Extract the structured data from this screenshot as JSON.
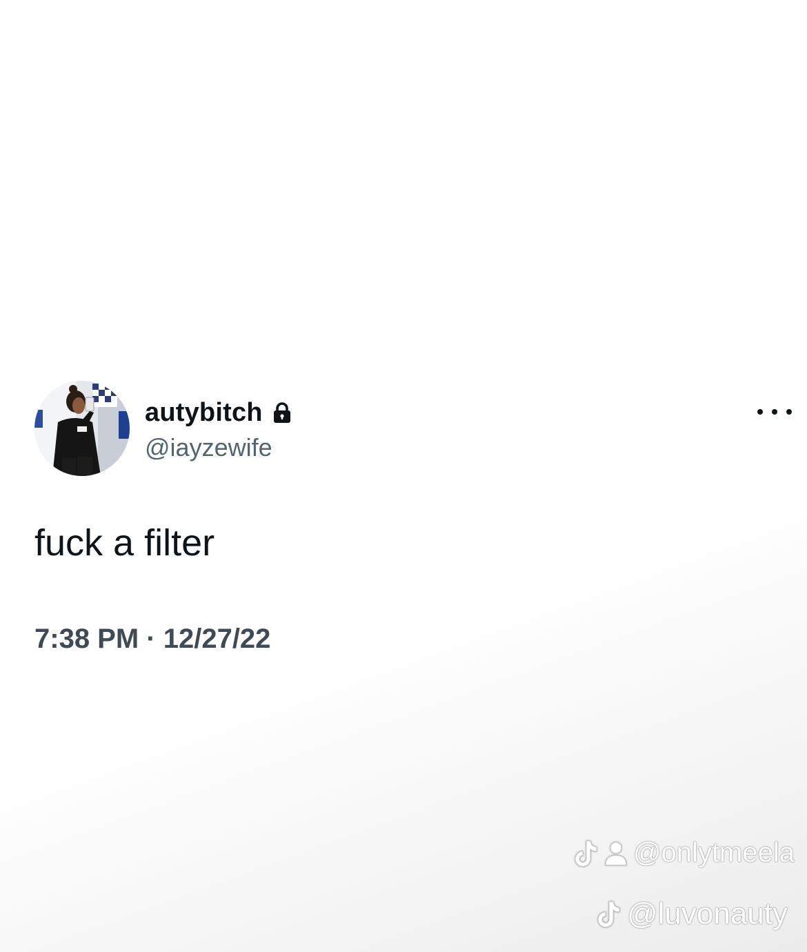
{
  "tweet": {
    "display_name": "autybitch",
    "handle": "@iayzewife",
    "protected_icon": "lock-icon",
    "more_icon": "more-horizontal-icon",
    "text": "fuck a filter",
    "timestamp": "7:38 PM · 12/27/22"
  },
  "watermarks": {
    "first": "@onlytmeela",
    "second": "@luvonauty",
    "icon": "tiktok-icon"
  },
  "colors": {
    "text_primary": "#0f1419",
    "text_secondary": "#536471",
    "timestamp": "#3f4a55",
    "background": "#ffffff"
  }
}
